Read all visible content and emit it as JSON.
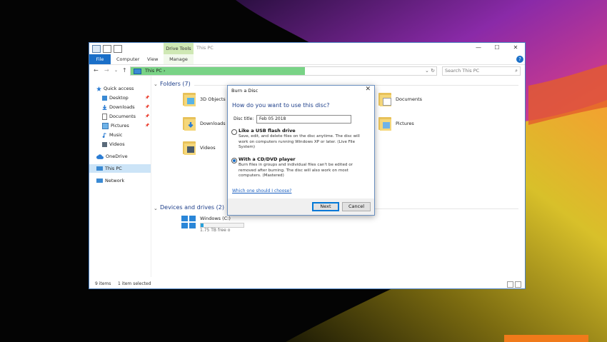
{
  "window": {
    "context_tab": "Drive Tools",
    "title": "This PC",
    "controls": {
      "minimize": "—",
      "maximize": "☐",
      "close": "✕"
    }
  },
  "ribbon": {
    "tabs": [
      "File",
      "Computer",
      "View",
      "Manage"
    ],
    "help": "?"
  },
  "address": {
    "back": "←",
    "forward": "→",
    "recent": "⌄",
    "up": "↑",
    "path": "This PC  ›",
    "dropdown": "⌄",
    "refresh": "↻",
    "search_placeholder": "Search This PC",
    "search_icon": "⌕"
  },
  "sidebar": {
    "items": [
      {
        "label": "Quick access",
        "pin": false
      },
      {
        "label": "Desktop",
        "pin": true
      },
      {
        "label": "Downloads",
        "pin": true
      },
      {
        "label": "Documents",
        "pin": true
      },
      {
        "label": "Pictures",
        "pin": true
      },
      {
        "label": "Music",
        "pin": false
      },
      {
        "label": "Videos",
        "pin": false
      },
      {
        "label": "OneDrive",
        "pin": false
      },
      {
        "label": "This PC",
        "pin": false,
        "selected": true
      },
      {
        "label": "Network",
        "pin": false
      }
    ],
    "pin_glyph": "📌"
  },
  "content": {
    "folders_header": "Folders (7)",
    "folders": {
      "objects3d": "3D Objects",
      "downloads": "Downloads",
      "videos": "Videos",
      "documents": "Documents",
      "pictures": "Pictures"
    },
    "drives_header": "Devices and drives (2)",
    "drive": {
      "name": "Windows (C:)",
      "meta": "1.75 TB free o",
      "used_fraction": 0.06
    },
    "section_chevron": "⌄"
  },
  "status": {
    "items": "9 items",
    "selected": "1 item selected"
  },
  "dialog": {
    "title": "Burn a Disc",
    "close": "✕",
    "question": "How do you want to use this disc?",
    "disc_title_label": "Disc title:",
    "disc_title_value": "Feb 05 2018",
    "option1": {
      "title": "Like a USB flash drive",
      "desc": "Save, edit, and delete files on the disc anytime. The disc will work on computers running Windows XP or later. (Live File System)",
      "selected": false
    },
    "option2": {
      "title": "With a CD/DVD player",
      "desc": "Burn files in groups and individual files can't be edited or removed after burning. The disc will also work on most computers. (Mastered)",
      "selected": true
    },
    "help_link": "Which one should I choose?",
    "next": "Next",
    "cancel": "Cancel"
  },
  "colors": {
    "accent": "#1a6fc8",
    "address_progress": "#79d386",
    "drive_tools_tab": "#cfe8b4",
    "background_orange": "#f07a1a"
  }
}
